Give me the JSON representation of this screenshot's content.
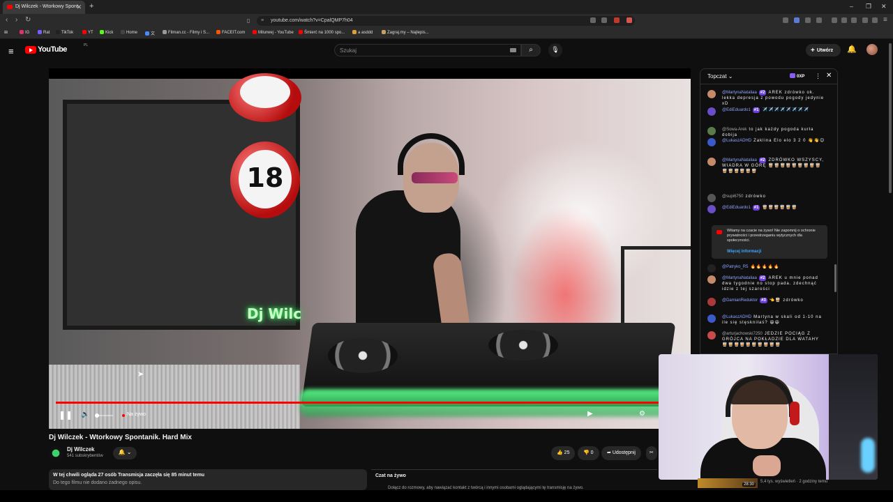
{
  "browser": {
    "tab_title": "Dj Wilczek - Wtorkowy Spont",
    "url": "youtube.com/watch?v=CpalQMP7h04",
    "bookmarks": [
      {
        "label": "IG",
        "color": "#e1306c"
      },
      {
        "label": "Rat",
        "color": "#7b5cff"
      },
      {
        "label": "TikTok",
        "color": "#222222"
      },
      {
        "label": "YT",
        "color": "#ff0000"
      },
      {
        "label": "Kick",
        "color": "#53fc18"
      },
      {
        "label": "Home",
        "color": "#444444"
      },
      {
        "label": "文",
        "color": "#4a8cff"
      },
      {
        "label": "Filman.cc - Filmy i S...",
        "color": "#999999"
      },
      {
        "label": "FACEIT.com",
        "color": "#ff5500"
      },
      {
        "label": "Milurwej - YouTube",
        "color": "#ff0000"
      },
      {
        "label": "Śmierć na 1000 spo...",
        "color": "#ff0000"
      },
      {
        "label": "a asddd",
        "color": "#e0a030"
      },
      {
        "label": "Zagraj.my – Najlepis...",
        "color": "#caa060"
      }
    ]
  },
  "youtube": {
    "logo_text": "YouTube",
    "logo_region": "PL",
    "search_placeholder": "Szukaj",
    "create_label": "Utwórz"
  },
  "player": {
    "live_label": "Na żywo",
    "neon_text": "Dj Wilc",
    "balloon_number": "18",
    "status": "live"
  },
  "video": {
    "title": "Dj Wilczek - Wtorkowy Spontanik. Hard Mix",
    "channel_name": "Dj Wilczek",
    "subscribers": "541 subskrybentów",
    "likes": "25",
    "dislikes": "0",
    "share_label": "Udostępnij",
    "description_line1": "W tej chwili ogląda 27 osób  Transmisja zaczęła się 85 minut temu",
    "description_line2": "Do tego filmu nie dodano żadnego opisu.",
    "livechat_title": "Czat na żywo",
    "livechat_sub": "Dołącz do rozmowy, aby nawiązać kontakt z twórcą i innymi osobami oglądającymi tę transmisję na żywo."
  },
  "chat": {
    "title": "Topczat",
    "points": "0XP",
    "messages": [
      {
        "author": "@MartynaNataliaa",
        "badge": "#2",
        "text": "AREK zdrówko ok. lekka depresja z powodu pogody jedynie xD",
        "avatar_color": "#c48a6a"
      },
      {
        "author": "@EdiEduardo1",
        "badge": "#1",
        "text": "✈️✈️✈️✈️✈️✈️✈️✈️",
        "avatar_color": "#6a4ec8"
      },
      {
        "author": "@Sowa-Arek",
        "badge": "",
        "text": "to jak każdy pogoda kurła dobija",
        "avatar_color": "#5a7a4a"
      },
      {
        "author": "@LukaszADHD",
        "badge": "",
        "text": "Zaklina Elo elo 3 2 0 👋👋😊",
        "avatar_color": "#3a5ac8"
      },
      {
        "author": "@MartynaNataliaa",
        "badge": "#2",
        "text": "ZDRÓWKO WSZYSCY, WIADRA W GÓRĘ 🥃🥃🥃🥃🥃🥃🥃🥃🥃🥃🥃🥃🥃🥃🥃",
        "avatar_color": "#c48a6a"
      },
      {
        "author": "@supi6750",
        "badge": "",
        "text": "zdrówko",
        "avatar_color": "#555555"
      },
      {
        "author": "@EdiEduardo1",
        "badge": "#1",
        "text": "🥃🥃🥃🥃🥃🥃",
        "avatar_color": "#6a4ec8"
      },
      {
        "author": "@Patryko_R5",
        "badge": "",
        "text": "🔥🔥🔥🔥🔥",
        "avatar_color": "#222222"
      },
      {
        "author": "@MartynaNataliaa",
        "badge": "#2",
        "text": "AREK u mnie ponad dwa tygodnie no stop pada. zdechnąć idzie z tej szarości",
        "avatar_color": "#c48a6a"
      },
      {
        "author": "@DamianReduktor",
        "badge": "#3",
        "text": "👈🥃 zdrówko",
        "avatar_color": "#a83a3a"
      },
      {
        "author": "@LukaszADHD",
        "badge": "",
        "text": "Martyna w skali od 1-10 na ile się stęskniłaś? 😆😆",
        "avatar_color": "#3a5ac8"
      },
      {
        "author": "@arturjachowski7250",
        "badge": "",
        "text": "JEDZIE POCIĄG Z GRÓJCA NA POKŁADZIE DLA WATAHY 🥃🥃🥃🥃🥃🥃🥃🥃🥃🥃",
        "avatar_color": "#c84a4a"
      }
    ],
    "notice_text": "Witamy na czacie na żywo! Nie zapomnij o ochronie prywatności i przestrzeganiu wytycznych dla społeczności.",
    "notice_link": "Więcej informacji"
  },
  "suggestion": {
    "duration": "28:30",
    "meta": "5,4 tys. wyświetleń · 2 godziny temu"
  },
  "colors": {
    "accent_red": "#ff0000",
    "link_blue": "#3ea6ff",
    "author_blue": "#8fa3ff",
    "badge_purple": "#6a3ed8"
  }
}
